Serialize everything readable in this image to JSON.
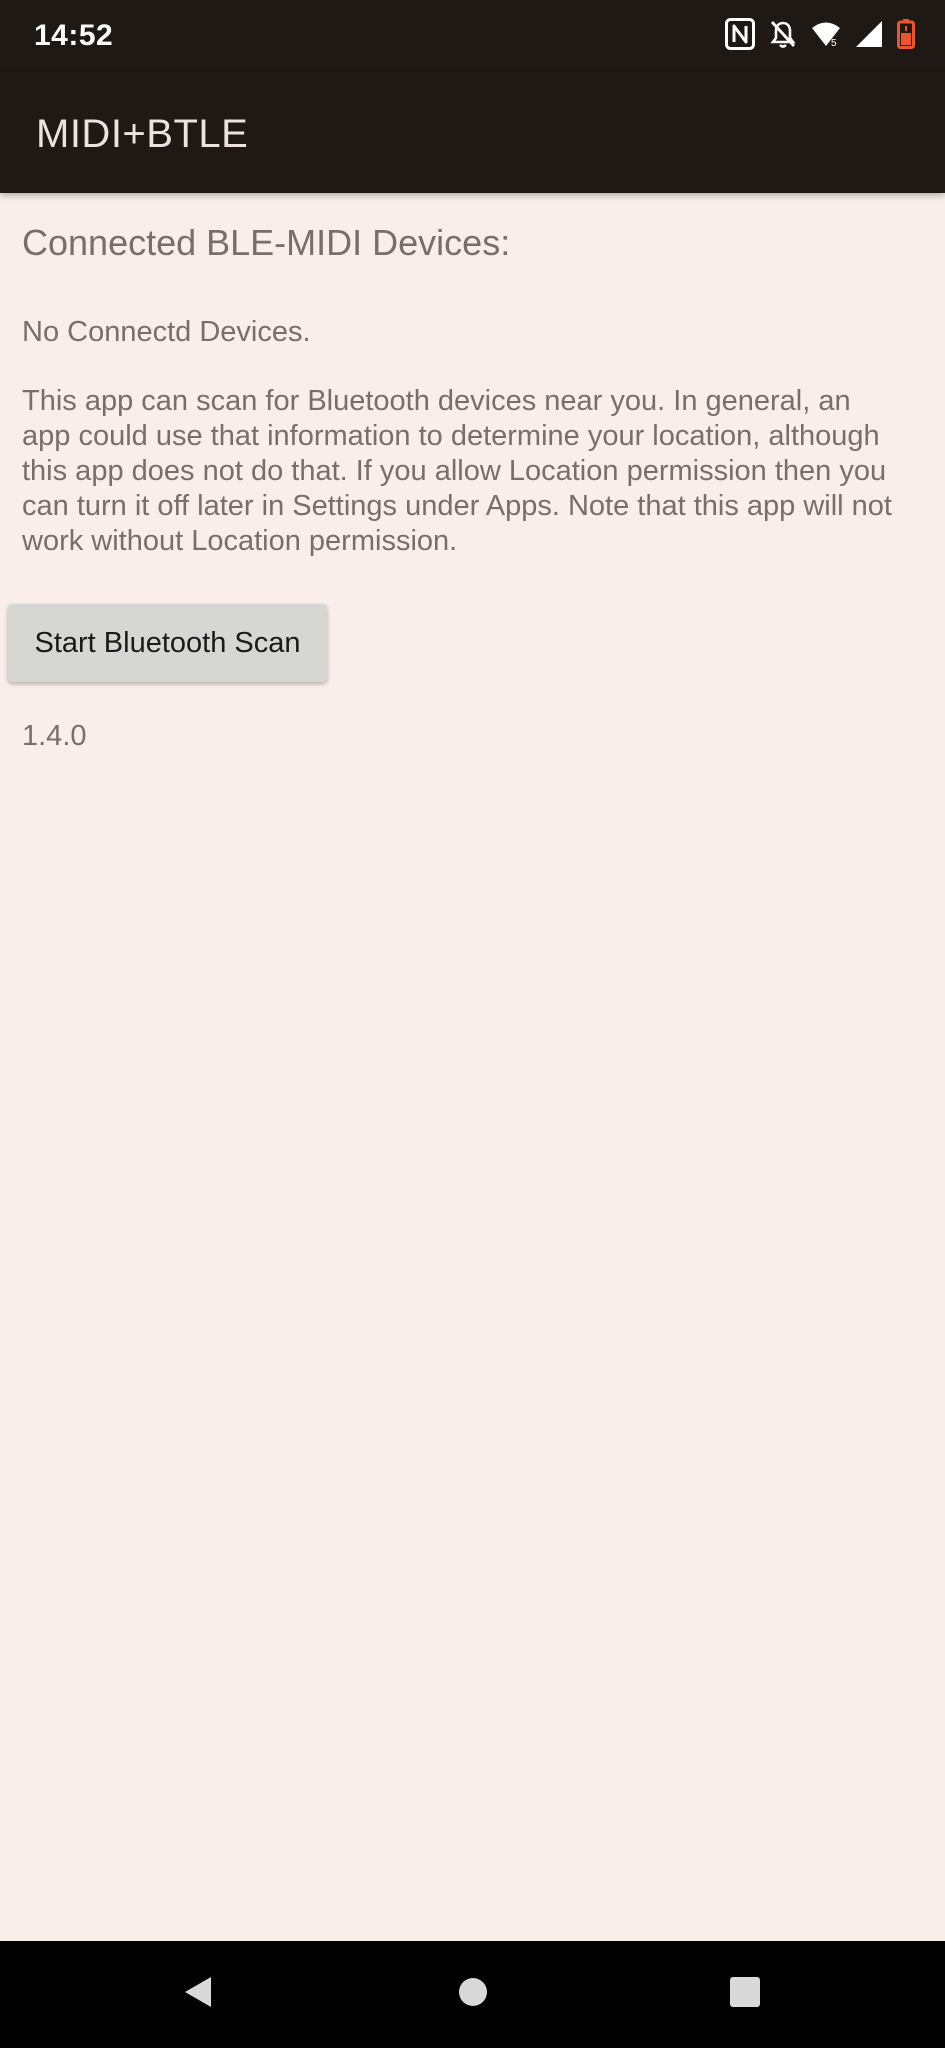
{
  "status_bar": {
    "time": "14:52",
    "icons": [
      "nfc-icon",
      "notifications-off-icon",
      "wifi-icon",
      "cell-signal-icon",
      "battery-low-icon"
    ],
    "battery_color": "#e8552f"
  },
  "app_bar": {
    "title": "MIDI+BTLE"
  },
  "main": {
    "heading": "Connected BLE-MIDI Devices:",
    "devices_status": "No Connectd Devices.",
    "notice": "This app can scan for Bluetooth devices near you. In general, an app could use that information to determine your location, although this app does not do that. If you allow Location permission then you can turn it off later in Settings under Apps. Note that this app will not work without Location permission.",
    "scan_button_label": "Start Bluetooth Scan",
    "version": "1.4.0"
  },
  "nav_bar": {
    "buttons": [
      "back-icon",
      "home-icon",
      "recents-icon"
    ]
  },
  "colors": {
    "background": "#faeeea",
    "app_bar": "#1f1916",
    "text_secondary": "#7a6e6a",
    "button": "#d6d6d4"
  }
}
